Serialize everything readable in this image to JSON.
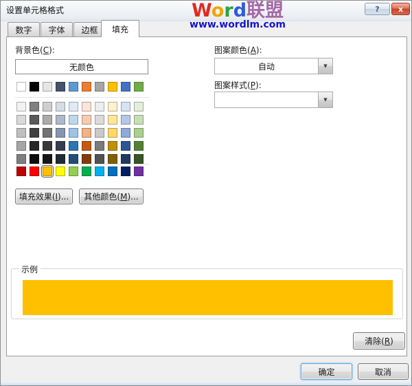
{
  "window": {
    "title": "设置单元格格式",
    "help_label": "?",
    "close_label": "x"
  },
  "watermark": {
    "letters": [
      {
        "ch": "W",
        "color": "#E02B20"
      },
      {
        "ch": "o",
        "color": "#F0A500"
      },
      {
        "ch": "r",
        "color": "#2FA042"
      },
      {
        "ch": "d",
        "color": "#2F5BDA"
      },
      {
        "ch": "联盟",
        "color": "#A668A8"
      }
    ],
    "url": "www.wordlm.com",
    "url_color": "#1515CC"
  },
  "tabs": [
    {
      "label": "数字",
      "active": false
    },
    {
      "label": "字体",
      "active": false
    },
    {
      "label": "边框",
      "active": false
    },
    {
      "label": "填充",
      "active": true
    }
  ],
  "fill_tab": {
    "background_color_label": "背景色(C):",
    "no_color_button": "无颜色",
    "pattern_color_label": "图案颜色(A):",
    "pattern_color_value": "自动",
    "pattern_style_label": "图案样式(P):",
    "pattern_style_value": "",
    "dropdown_arrow": "▼",
    "fill_effects_button": "填充效果(I)...",
    "more_colors_button": "其他颜色(M)...",
    "sample_label": "示例",
    "sample_fill_color": "#FFC000",
    "clear_button": "清除(R)",
    "palette": {
      "theme_row": [
        "#FFFFFF",
        "#000000",
        "#E7E6E6",
        "#44546A",
        "#5B9BD5",
        "#ED7D31",
        "#A5A5A5",
        "#FFC000",
        "#4472C4",
        "#70AD47"
      ],
      "tint_rows": [
        [
          "#F2F2F2",
          "#808080",
          "#D0CECE",
          "#D6DCE4",
          "#DEEBF7",
          "#FBE5D6",
          "#EDEDED",
          "#FFF2CC",
          "#D9E2F3",
          "#E2EFDA"
        ],
        [
          "#D9D9D9",
          "#595959",
          "#AEAAAA",
          "#ACB9CA",
          "#BDD7EE",
          "#F8CBAD",
          "#DBDBDB",
          "#FFE699",
          "#B4C7E7",
          "#C6E0B4"
        ],
        [
          "#BFBFBF",
          "#404040",
          "#757171",
          "#8496B0",
          "#9DC3E6",
          "#F4B183",
          "#C9C9C9",
          "#FFD966",
          "#8EAADB",
          "#A9D18E"
        ],
        [
          "#A6A6A6",
          "#262626",
          "#3A3838",
          "#333F50",
          "#2E75B6",
          "#C55A11",
          "#7B7B7B",
          "#BF9000",
          "#2F5496",
          "#548235"
        ],
        [
          "#7F7F7F",
          "#0D0D0D",
          "#171616",
          "#222B35",
          "#1F4E79",
          "#843C0C",
          "#525252",
          "#7F6000",
          "#1F3864",
          "#375623"
        ]
      ],
      "standard_row": [
        "#C00000",
        "#FF0000",
        "#FFC000",
        "#FFFF00",
        "#92D050",
        "#00B050",
        "#00B0F0",
        "#0070C0",
        "#002060",
        "#7030A0"
      ],
      "selected_standard_index": 2
    }
  },
  "footer": {
    "ok_button": "确定",
    "cancel_button": "取消"
  }
}
